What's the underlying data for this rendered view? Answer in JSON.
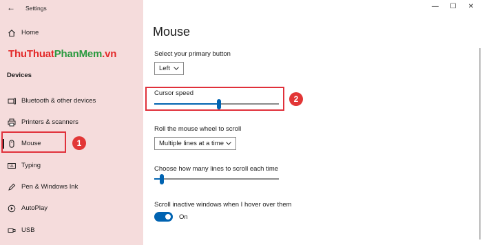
{
  "window": {
    "title": "Settings",
    "minimize_glyph": "—",
    "maximize_glyph": "☐",
    "close_glyph": "✕",
    "back_glyph": "←"
  },
  "sidebar": {
    "home_label": "Home",
    "watermark": {
      "part1": "ThuThuat",
      "part2": "PhanMem",
      "part3": ".vn"
    },
    "section": "Devices",
    "items": [
      {
        "label": "Bluetooth & other devices",
        "icon": "bluetooth-devices-icon"
      },
      {
        "label": "Printers & scanners",
        "icon": "printer-icon"
      },
      {
        "label": "Mouse",
        "icon": "mouse-icon",
        "selected": true
      },
      {
        "label": "Typing",
        "icon": "keyboard-icon"
      },
      {
        "label": "Pen & Windows Ink",
        "icon": "pen-icon"
      },
      {
        "label": "AutoPlay",
        "icon": "autoplay-icon"
      },
      {
        "label": "USB",
        "icon": "usb-icon"
      }
    ],
    "annotation_badge": "1"
  },
  "main": {
    "title": "Mouse",
    "primary_button": {
      "label": "Select your primary button",
      "value": "Left"
    },
    "cursor_speed": {
      "label": "Cursor speed",
      "level": 0.52
    },
    "cursor_annotation_badge": "2",
    "wheel_scroll": {
      "label": "Roll the mouse wheel to scroll",
      "value": "Multiple lines at a time"
    },
    "lines_to_scroll": {
      "label": "Choose how many lines to scroll each time",
      "level": 0.06
    },
    "inactive_scroll": {
      "label": "Scroll inactive windows when I hover over them",
      "state": "On"
    }
  },
  "colors": {
    "sidebar_bg": "#f5dcdc",
    "accent": "#0063b1",
    "annotation_red": "#e0303a"
  }
}
